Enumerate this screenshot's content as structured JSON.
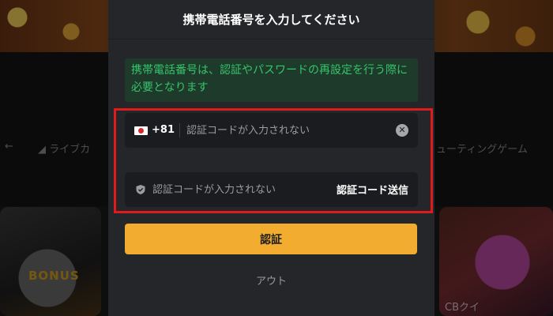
{
  "background": {
    "nav_left": "ライブカ",
    "nav_right": "ューティングゲーム",
    "tile_left_label": "BONUS",
    "tile_right_label": "CBクイ"
  },
  "modal": {
    "title": "携帯電話番号を入力してください",
    "notice": "携帯電話番号は、認証やパスワードの再設定を行う際に必要となります",
    "phone": {
      "country_code": "+81",
      "placeholder": "認証コードが入力されない",
      "clear_icon": "close-circle-icon"
    },
    "verification": {
      "placeholder": "認証コードが入力されない",
      "send_label": "認証コード送信",
      "shield_icon": "shield-icon"
    },
    "submit_label": "認証",
    "logout_label": "アウト"
  },
  "colors": {
    "accent": "#f2ac2f",
    "notice_text": "#36c46b",
    "highlight": "#e01b1b"
  }
}
